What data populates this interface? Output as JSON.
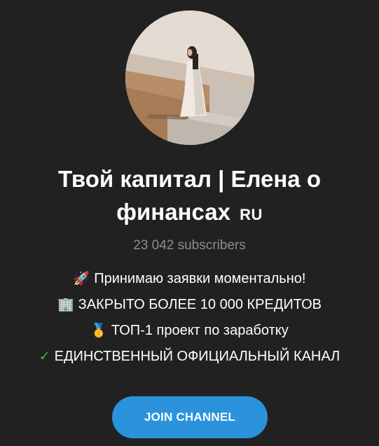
{
  "channel": {
    "title": "Твой капитал | Елена о финансах",
    "title_badge": "RU",
    "subscribers": "23 042 subscribers",
    "description": [
      {
        "icon": "rocket-icon",
        "emoji": "🚀",
        "text": "Принимаю заявки моментально!"
      },
      {
        "icon": "office-building-icon",
        "emoji": "🏢",
        "text": "ЗАКРЫТО БОЛЕЕ 10 000 КРЕДИТОВ"
      },
      {
        "icon": "medal-icon",
        "emoji": "🥇",
        "text": "ТОП-1 проект по заработку"
      },
      {
        "icon": "check-mark-icon",
        "emoji": "✓",
        "text": "ЕДИНСТВЕННЫЙ ОФИЦИАЛЬНЫЙ КАНАЛ"
      }
    ],
    "join_label": "JOIN CHANNEL"
  },
  "colors": {
    "background": "#212121",
    "button": "#2b93dc",
    "muted_text": "#8d8d8d",
    "check": "#4caf50"
  }
}
